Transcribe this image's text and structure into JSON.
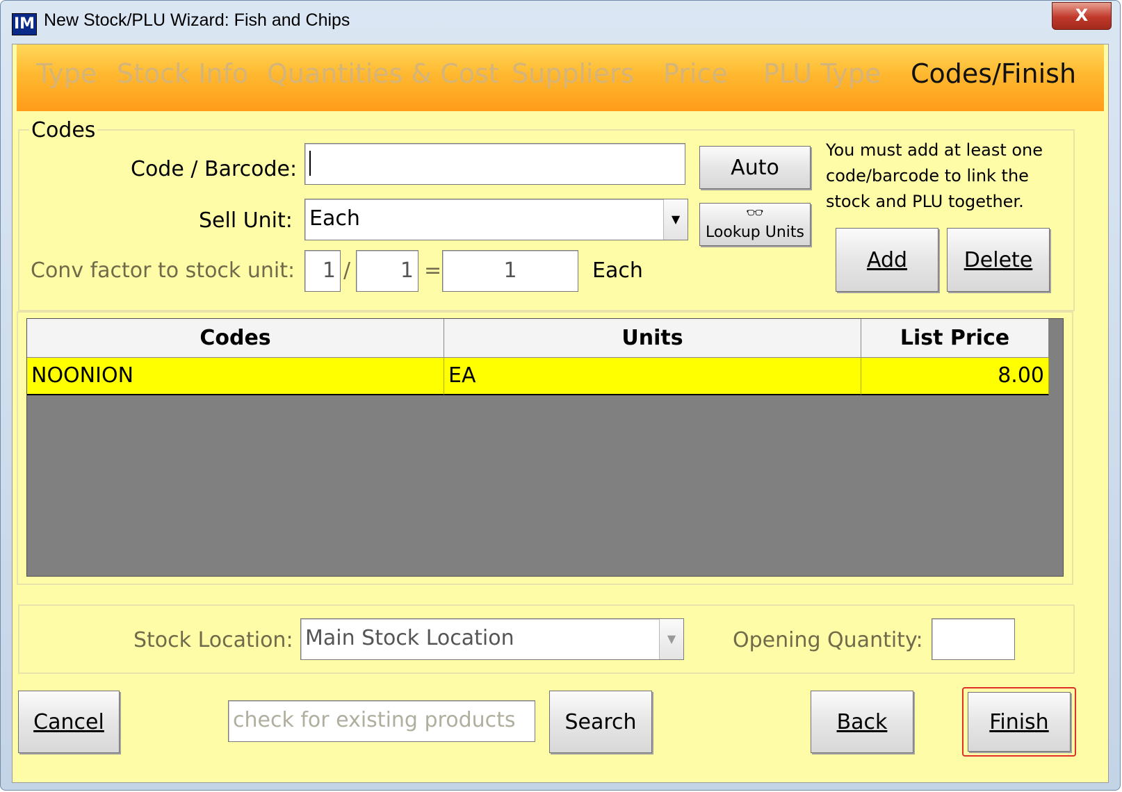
{
  "window": {
    "app_icon": "IM",
    "title": "New Stock/PLU Wizard: Fish and Chips",
    "close_label": "X"
  },
  "steps": [
    {
      "label": "Type",
      "active": false
    },
    {
      "label": "Stock Info",
      "active": false
    },
    {
      "label": "Quantities & Cost",
      "active": false
    },
    {
      "label": "Suppliers",
      "active": false
    },
    {
      "label": "Price",
      "active": false
    },
    {
      "label": "PLU Type",
      "active": false
    },
    {
      "label": "Codes/Finish",
      "active": true
    }
  ],
  "codes": {
    "group_label": "Codes",
    "barcode_label": "Code / Barcode:",
    "barcode_value": "",
    "auto_label": "Auto",
    "sell_unit_label": "Sell Unit:",
    "sell_unit_value": "Each",
    "lookup_units_label": "Lookup Units",
    "conv_label": "Conv factor to stock unit:",
    "conv_num": "1",
    "conv_slash": "/",
    "conv_den": "1",
    "conv_equals": "=",
    "conv_result": "1",
    "conv_unit": "Each",
    "hint": "You must add at least one code/barcode to link the stock and PLU together.",
    "add_label": "Add",
    "delete_label": "Delete"
  },
  "table": {
    "columns": [
      "Codes",
      "Units",
      "List Price"
    ],
    "rows": [
      {
        "code": "NOONION",
        "unit": "EA",
        "price": "8.00"
      }
    ]
  },
  "location": {
    "stock_location_label": "Stock Location:",
    "stock_location_value": "Main Stock Location",
    "opening_qty_label": "Opening Quantity:",
    "opening_qty_value": ""
  },
  "footer": {
    "cancel_label": "Cancel",
    "search_placeholder": "check for existing products",
    "search_label": "Search",
    "back_label": "Back",
    "finish_label": "Finish"
  },
  "colors": {
    "panel_bg": "#fffca8",
    "header_orange": "#ffb830",
    "selected_row": "#ffff00",
    "finish_highlight": "#e0302a"
  }
}
